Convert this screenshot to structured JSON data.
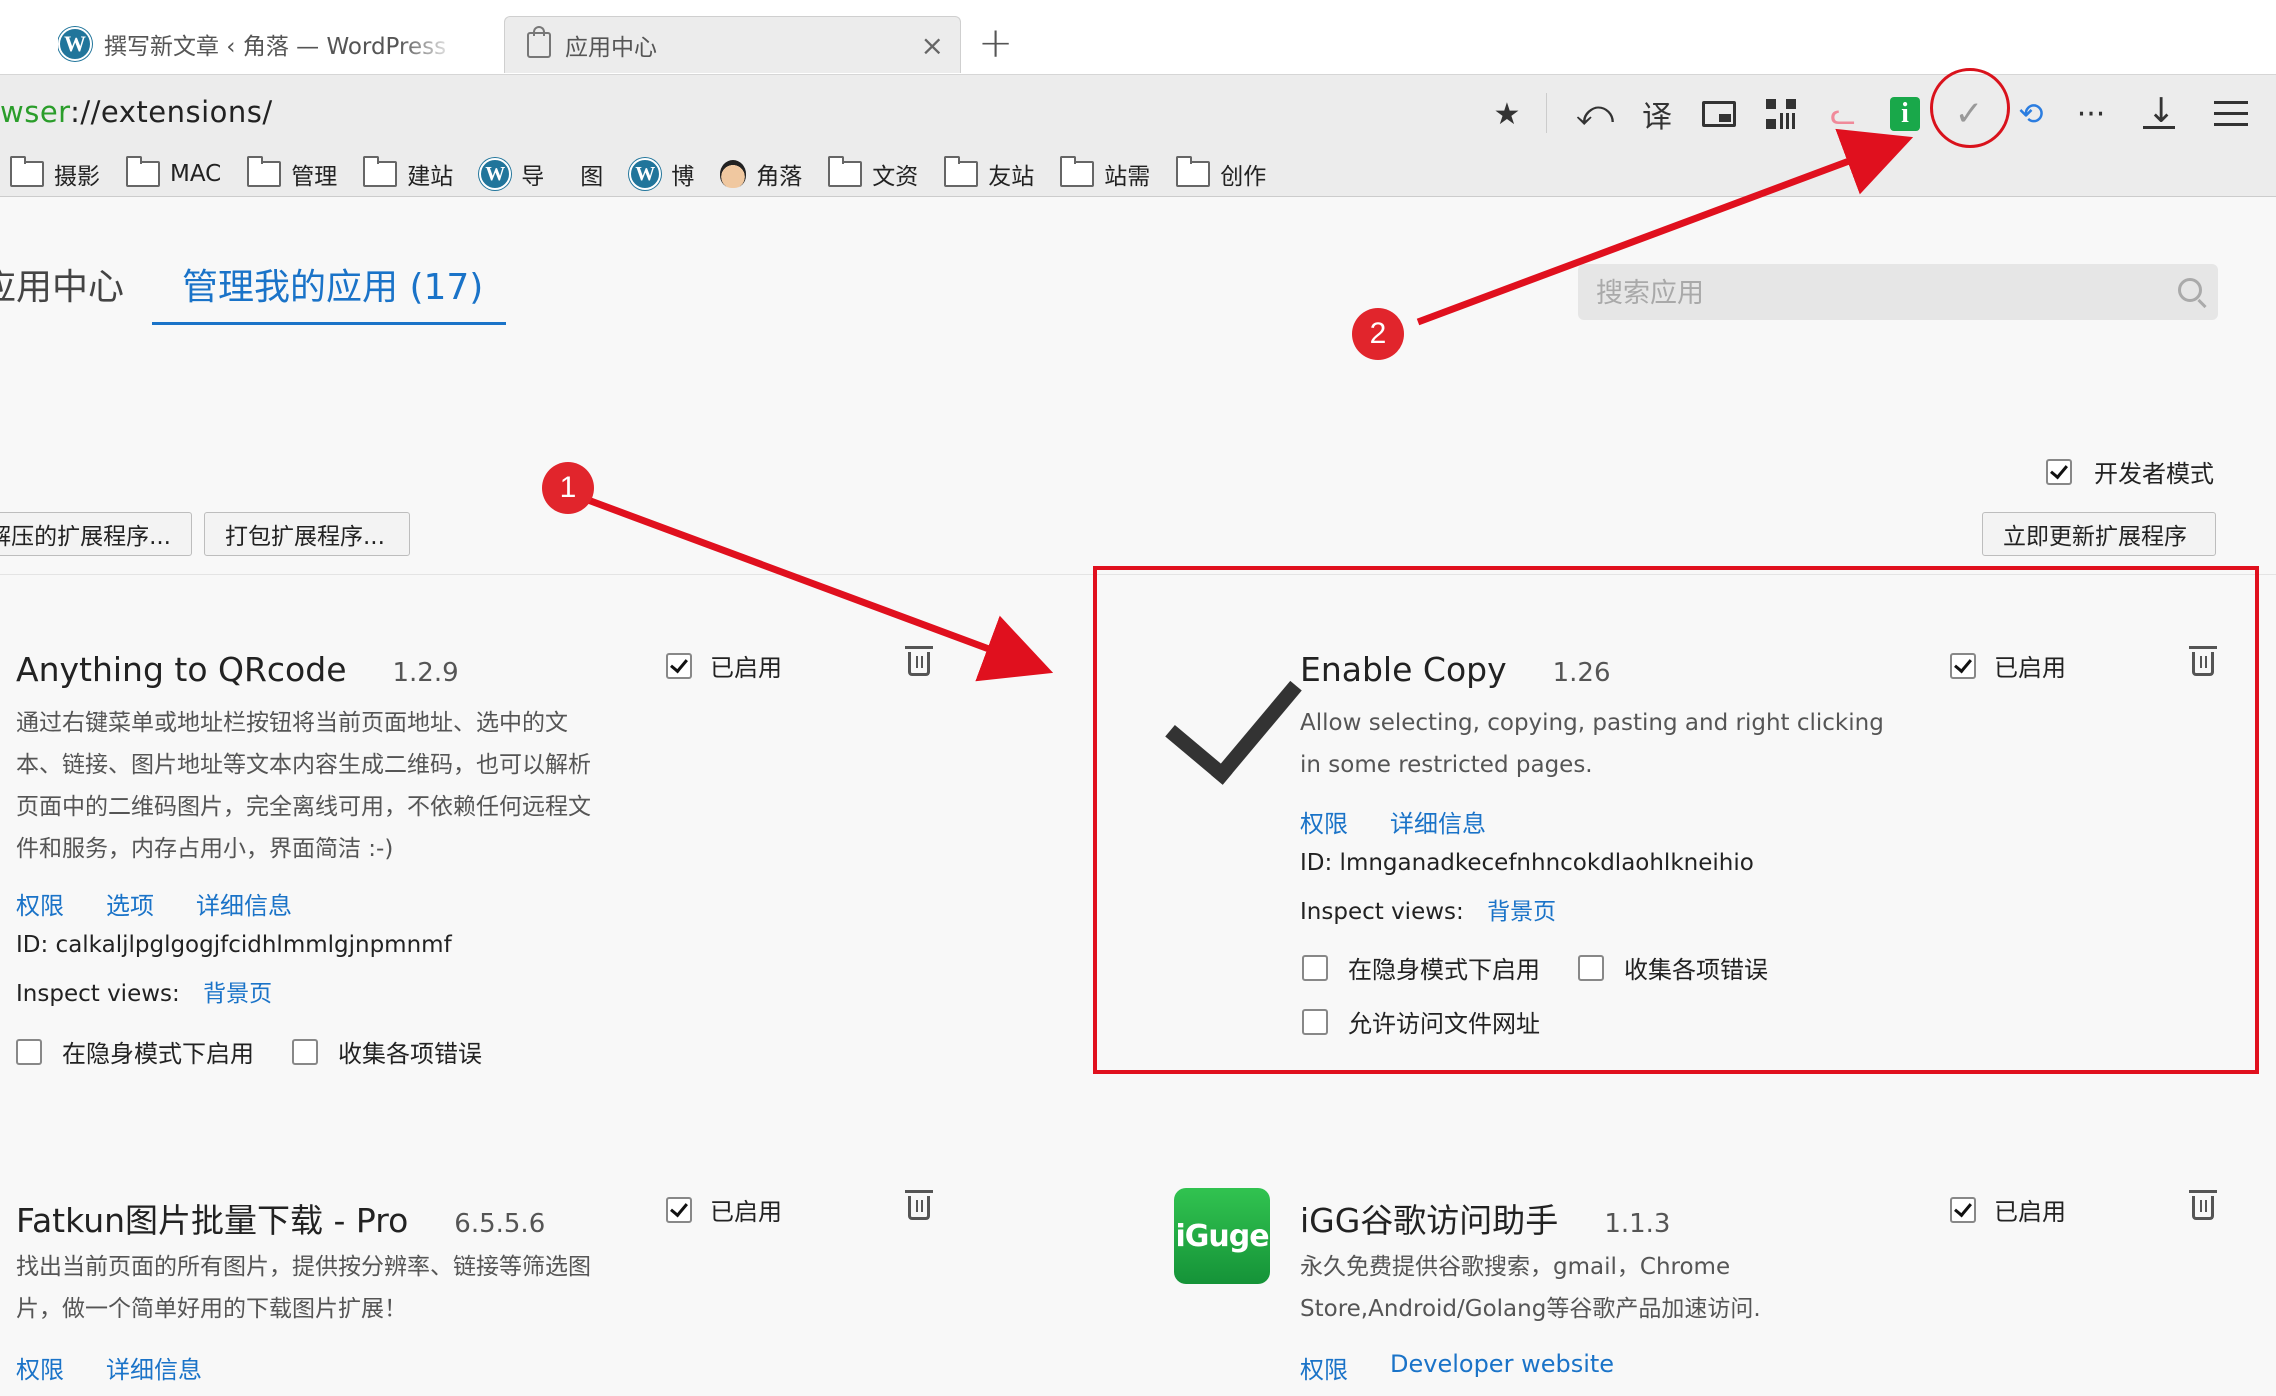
{
  "tabs": [
    {
      "title": "撰写新文章 ‹ 角落 — WordPress",
      "icon": "wordpress-icon"
    },
    {
      "title": "应用中心",
      "icon": "shopping-bag-icon",
      "active": true
    }
  ],
  "address_bar": {
    "url_scheme": "wser",
    "url_rest": "://extensions/"
  },
  "toolbar": {
    "icons": [
      "star-icon",
      "undo-icon",
      "translate-icon",
      "pip-icon",
      "qrcode-icon",
      "cat-icon",
      "green-i-icon",
      "enable-copy-check-icon",
      "sync-icon",
      "more-icon",
      "download-icon",
      "menu-icon"
    ],
    "translate_glyph": "译",
    "more_glyph": "···"
  },
  "bookmarks": [
    {
      "label": "摄影",
      "icon": "folder-icon"
    },
    {
      "label": "MAC",
      "icon": "folder-icon"
    },
    {
      "label": "管理",
      "icon": "folder-icon"
    },
    {
      "label": "建站",
      "icon": "folder-icon"
    },
    {
      "label": "导",
      "icon": "wordpress-icon"
    },
    {
      "label": "图",
      "icon": "apple-icon"
    },
    {
      "label": "博",
      "icon": "wordpress-icon"
    },
    {
      "label": "角落",
      "icon": "avatar-icon"
    },
    {
      "label": "文资",
      "icon": "folder-icon"
    },
    {
      "label": "友站",
      "icon": "folder-icon"
    },
    {
      "label": "站需",
      "icon": "folder-icon"
    },
    {
      "label": "创作",
      "icon": "folder-icon"
    }
  ],
  "page": {
    "nav_apps": "应用中心",
    "nav_manage": "管理我的应用 (17)",
    "search_placeholder": "搜索应用",
    "dev_mode_label": "开发者模式",
    "dev_mode_checked": true,
    "btn_load": "解压的扩展程序...",
    "btn_pack": "打包扩展程序...",
    "btn_update": "立即更新扩展程序"
  },
  "extensions": [
    {
      "name": "Anything to QRcode",
      "version": "1.2.9",
      "enabled_label": "已启用",
      "enabled": true,
      "description": "通过右键菜单或地址栏按钮将当前页面地址、选中的文本、链接、图片地址等文本内容生成二维码，也可以解析页面中的二维码图片，完全离线可用，不依赖任何远程文件和服务，内存占用小，界面简洁 :-)",
      "links": [
        "权限",
        "选项",
        "详细信息"
      ],
      "id_line": "ID: calkaljlpglgogjfcidhlmmlgjnpmnmf",
      "inspect_label": "Inspect views:",
      "inspect_link": "背景页",
      "options": [
        "在隐身模式下启用",
        "收集各项错误"
      ]
    },
    {
      "name": "Enable Copy",
      "version": "1.26",
      "enabled_label": "已启用",
      "enabled": true,
      "icon": "big-check-icon",
      "description": "Allow selecting, copying, pasting and right clicking in some restricted pages.",
      "links": [
        "权限",
        "详细信息"
      ],
      "id_line": "ID: lmnganadkecefnhncokdlaohlkneihio",
      "inspect_label": "Inspect views:",
      "inspect_link": "背景页",
      "options": [
        "在隐身模式下启用",
        "收集各项错误",
        "允许访问文件网址"
      ]
    },
    {
      "name": "Fatkun图片批量下载 - Pro",
      "version": "6.5.5.6",
      "enabled_label": "已启用",
      "enabled": true,
      "description": "找出当前页面的所有图片，提供按分辨率、链接等筛选图片，做一个简单好用的下载图片扩展！",
      "links": [
        "权限",
        "详细信息"
      ]
    },
    {
      "name": "iGG谷歌访问助手",
      "version": "1.1.3",
      "enabled_label": "已启用",
      "enabled": true,
      "icon_text": "iGuge",
      "description": "永久免费提供谷歌搜索，gmail，Chrome Store,Android/Golang等谷歌产品加速访问.",
      "links": [
        "权限",
        "Developer website"
      ]
    }
  ],
  "annotations": {
    "badge_1": "1",
    "badge_2": "2",
    "color": "#e0101e"
  }
}
